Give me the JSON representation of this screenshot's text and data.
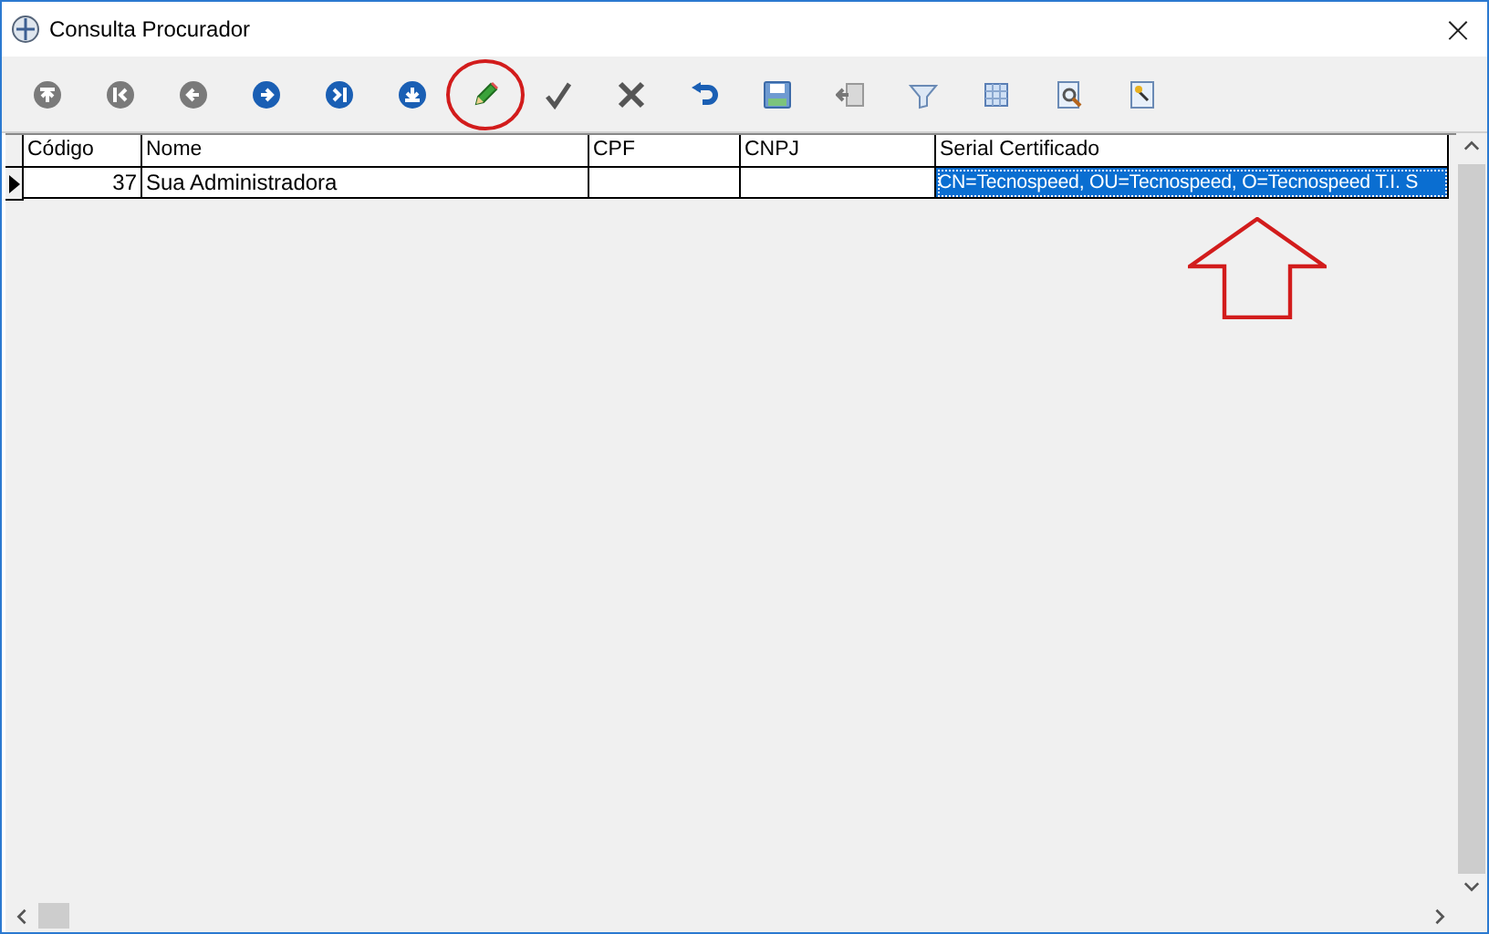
{
  "window": {
    "title": "Consulta Procurador",
    "close": "×"
  },
  "table": {
    "columns": [
      "Código",
      "Nome",
      "CPF",
      "CNPJ",
      "Serial Certificado"
    ],
    "rows": [
      {
        "current": true,
        "cells": [
          {
            "text": "37",
            "selected": false
          },
          {
            "text": "Sua Administradora",
            "selected": false
          },
          {
            "text": "",
            "selected": false
          },
          {
            "text": "",
            "selected": false
          },
          {
            "text": "CN=Tecnospeed, OU=Tecnospeed, O=Tecnospeed T.I. S",
            "selected": true
          }
        ]
      }
    ]
  }
}
